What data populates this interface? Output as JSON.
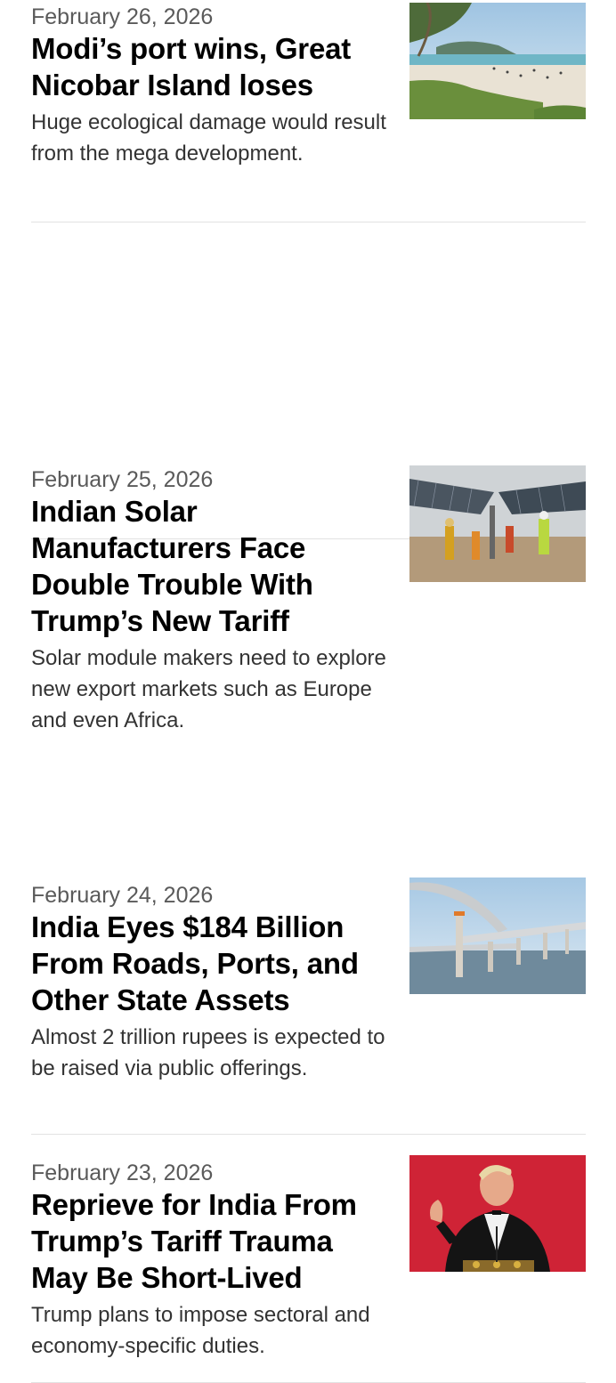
{
  "articles": [
    {
      "date": "February 26, 2026",
      "headline": "Modi’s port wins, Great Nicobar Island loses",
      "summary": "Huge ecological damage would result from the mega development.",
      "image": "beach-photo"
    },
    {
      "date": "February 25, 2026",
      "headline": "Indian Solar Manufacturers Face Double Trouble With Trump’s New Tariff",
      "summary": "Solar module makers need to explore new export markets such as Europe and even Africa.",
      "image": "solar-panels-photo"
    },
    {
      "date": "February 24, 2026",
      "headline": "India Eyes $184 Billion From Roads, Ports, and Other State Assets",
      "summary": "Almost 2 trillion rupees is expected to be raised via public offerings.",
      "image": "bridge-photo"
    },
    {
      "date": "February 23, 2026",
      "headline": "Reprieve for India From Trump’s Tariff Trauma May Be Short-Lived",
      "summary": "Trump plans to impose sectoral and economy-specific duties.",
      "image": "speaker-photo"
    }
  ]
}
